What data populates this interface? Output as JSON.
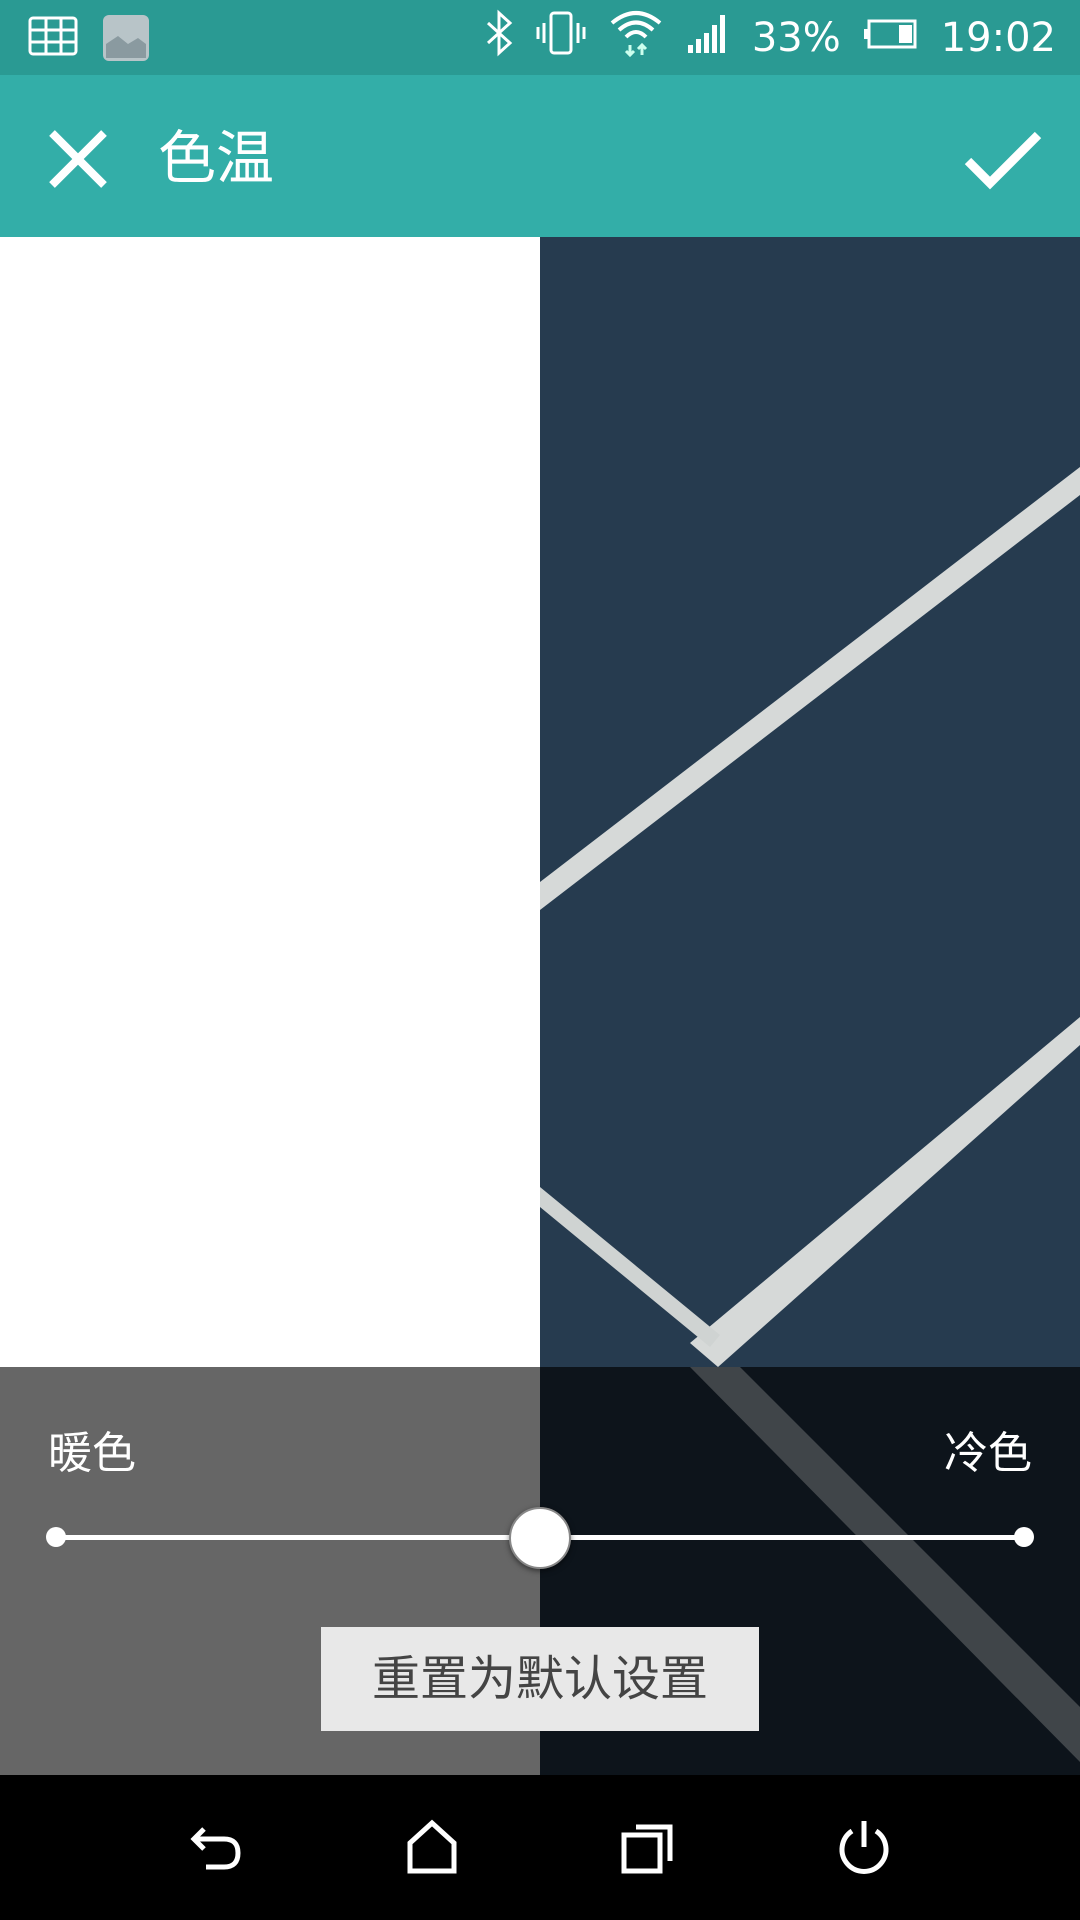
{
  "status_bar": {
    "battery_percent": "33%",
    "time": "19:02",
    "icons": [
      "grid-icon",
      "image-thumb-icon",
      "bluetooth-icon",
      "vibrate-icon",
      "wifi-icon",
      "signal-icon",
      "battery-icon"
    ]
  },
  "app_bar": {
    "title": "色温",
    "close_icon": "close-icon",
    "confirm_icon": "checkmark-icon",
    "color": "#33aea8"
  },
  "controls": {
    "warm_label": "暖色",
    "cool_label": "冷色",
    "slider_value": 0.5,
    "reset_label": "重置为默认设置"
  },
  "nav_bar": {
    "icons": [
      "back-icon",
      "home-icon",
      "recents-icon",
      "power-icon"
    ]
  }
}
